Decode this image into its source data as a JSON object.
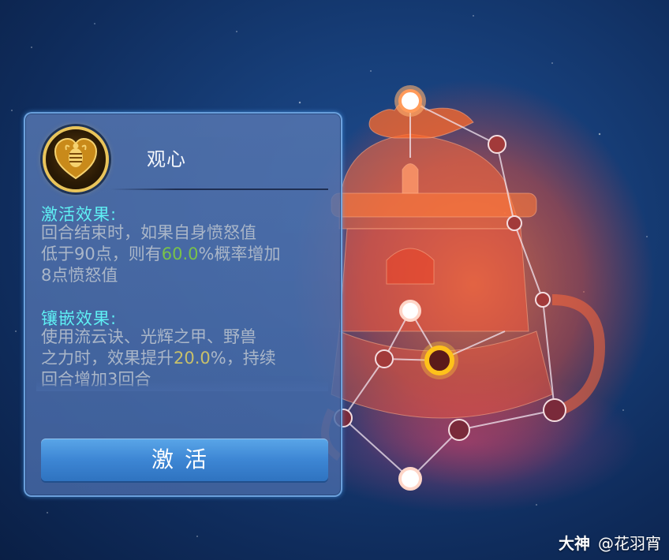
{
  "skill": {
    "name": "观心",
    "icon": "heart-bee-emblem"
  },
  "activation": {
    "title": "激活效果:",
    "line1": "回合结束时，如果自身愤怒值",
    "line2_pre": "低于90点，则有",
    "line2_value": "60.0",
    "line2_post": "%概率增加",
    "line3": "8点愤怒值"
  },
  "inlay": {
    "title": "镶嵌效果:",
    "line1": "使用流云诀、光辉之甲、野兽",
    "line2_pre": "之力时，效果提升",
    "line2_value": "20.0",
    "line2_post": "%，持续",
    "line3": "回合增加3回合"
  },
  "button": {
    "activate_label": "激活"
  },
  "watermark": {
    "brand": "大神",
    "user": "@花羽宵"
  },
  "colors": {
    "section_title": "#5ff0f4",
    "value_green": "#79c24a",
    "value_yellow": "#c8c06a",
    "constellation_orange": "#ff6a2a",
    "selected_node": "#ffc21a"
  }
}
